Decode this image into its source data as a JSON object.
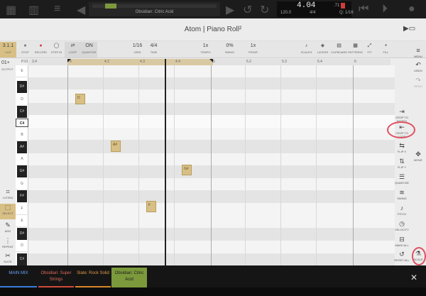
{
  "top": {
    "song": "Obsidian: Citric Acid",
    "position": "4.04",
    "position_sub": ".71",
    "bpm": "120.0",
    "sig": "4/4",
    "quant": "Q: 1/16",
    "record_label": "R"
  },
  "title": "Atom | Piano Roll²",
  "toolbar": [
    {
      "value": "3.1.1",
      "label": "CLIP"
    },
    {
      "value": "⏸",
      "label": "STOP"
    },
    {
      "value": "●",
      "label": "RECORD"
    },
    {
      "value": "◯",
      "label": "STEP IN"
    },
    {
      "value": "⇄",
      "label": "LOOP"
    },
    {
      "value": "ON",
      "label": "QUANTIZE"
    },
    {
      "value": "1/16",
      "label": "GRID"
    },
    {
      "value": "4/4",
      "label": "TIME"
    },
    {
      "value": "1x",
      "label": "TEMPO"
    },
    {
      "value": "0%",
      "label": "SWING"
    },
    {
      "value": "1x",
      "label": "PRIOR"
    },
    {
      "value": "♪",
      "label": "SCALES"
    },
    {
      "value": "◈",
      "label": "LAYERS"
    },
    {
      "value": "▤",
      "label": "CLIPBOARD"
    },
    {
      "value": "▦",
      "label": "PATTERNS"
    },
    {
      "value": "⤢",
      "label": "FIT"
    },
    {
      "value": "+",
      "label": "FILL"
    }
  ],
  "ruler": [
    "3.4",
    "4",
    "4.2",
    "4.3",
    "4.4",
    "5",
    "5.2",
    "5.3",
    "5.4",
    "6"
  ],
  "output": {
    "value": "01+",
    "label": "OUTPUT",
    "channel": "P.01"
  },
  "keys": [
    "E",
    "D#",
    "D",
    "C#",
    "C4",
    "B",
    "A#",
    "A",
    "G#",
    "G",
    "F#",
    "F",
    "E",
    "D#",
    "D",
    "C#"
  ],
  "notes": [
    {
      "label": "D"
    },
    {
      "label": "A#"
    },
    {
      "label": "G#"
    },
    {
      "label": "F"
    }
  ],
  "left_tools": [
    "LISTEN",
    "SELECT",
    "ADD",
    "REPEAT",
    "SLICE"
  ],
  "right_tools": [
    "CROP TO NOTES",
    "CROP TO LOOP",
    "FLIP X",
    "FLIP Y",
    "QUANTIZE",
    "SWING",
    "PITCH",
    "VELOCITY",
    "MAKE ALL",
    "RESET ALL"
  ],
  "right_tools2": [
    "MENU",
    "UNDO",
    "REDO",
    "MOVE",
    "SCALE"
  ],
  "tracks": [
    {
      "name": "MAIN MIX",
      "color": "#3b7bd8"
    },
    {
      "name": "Obsidian: Super Strings",
      "color": "#d04a3a"
    },
    {
      "name": "Slate: Rock Solid",
      "color": "#d8862b"
    },
    {
      "name": "Obsidian: Citric Acid",
      "color": "#7c9a3c"
    }
  ],
  "colors": {
    "note": "#d8bf85",
    "loop": "#d9c9a3",
    "accent": "#7c9a3c"
  }
}
